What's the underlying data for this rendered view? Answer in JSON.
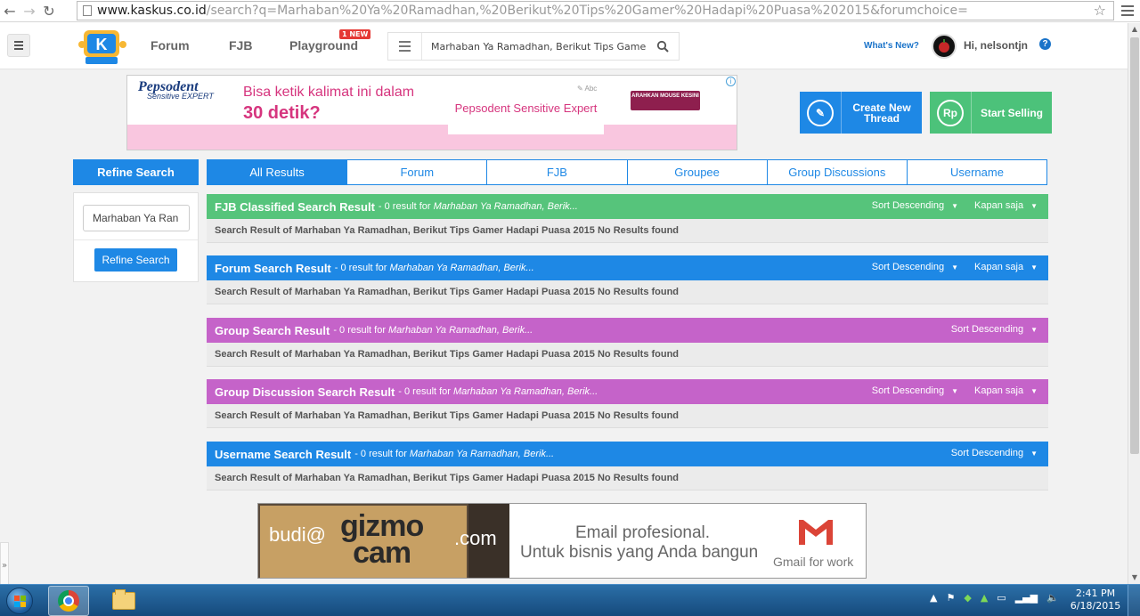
{
  "browser": {
    "url_host": "www.kaskus.co.id",
    "url_rest": "/search?q=Marhaban%20Ya%20Ramadhan,%20Berikut%20Tips%20Gamer%20Hadapi%20Puasa%202015&forumchoice="
  },
  "header": {
    "nav": [
      {
        "label": "Forum"
      },
      {
        "label": "FJB"
      },
      {
        "label": "Playground"
      }
    ],
    "new_badge": "1 NEW",
    "search_value": "Marhaban Ya Ramadhan, Berikut Tips Game",
    "whats_new": "What's New?",
    "greeting": "Hi, nelsontjn",
    "help": "?"
  },
  "ad_top": {
    "brand": "Pepsodent",
    "brand_sub": "Sensitive EXPERT",
    "line1": "Bisa ketik kalimat ini dalam",
    "line2": "30 detik?",
    "middle_text": "Pepsodent Sensitive Expert",
    "abc": "✎ Abc",
    "button": "ARAHKAN MOUSE KESINI",
    "info": "i"
  },
  "actions": {
    "create_thread": "Create New Thread",
    "start_selling": "Start Selling",
    "rp_icon": "Rp"
  },
  "refine": {
    "title": "Refine Search",
    "input_value": "Marhaban Ya Ran",
    "button": "Refine Search"
  },
  "tabs": [
    {
      "label": "All Results",
      "active": true
    },
    {
      "label": "Forum"
    },
    {
      "label": "FJB"
    },
    {
      "label": "Groupee"
    },
    {
      "label": "Group Discussions"
    },
    {
      "label": "Username"
    }
  ],
  "results": [
    {
      "title": "FJB Classified Search Result",
      "meta": "- 0 result for",
      "query": "Marhaban Ya Ramadhan, Berik...",
      "sort": "Sort Descending",
      "when": "Kapan saja",
      "body": "Search Result of Marhaban Ya Ramadhan, Berikut Tips Gamer Hadapi Puasa 2015 No Results found",
      "color": "#56c47b"
    },
    {
      "title": "Forum Search Result",
      "meta": "- 0 result for",
      "query": "Marhaban Ya Ramadhan, Berik...",
      "sort": "Sort Descending",
      "when": "Kapan saja",
      "body": "Search Result of Marhaban Ya Ramadhan, Berikut Tips Gamer Hadapi Puasa 2015 No Results found",
      "color": "#1e88e5"
    },
    {
      "title": "Group Search Result",
      "meta": "- 0 result for",
      "query": "Marhaban Ya Ramadhan, Berik...",
      "sort": "Sort Descending",
      "body": "Search Result of Marhaban Ya Ramadhan, Berikut Tips Gamer Hadapi Puasa 2015 No Results found",
      "color": "#c563c9"
    },
    {
      "title": "Group Discussion Search Result",
      "meta": "- 0 result for",
      "query": "Marhaban Ya Ramadhan, Berik...",
      "sort": "Sort Descending",
      "when": "Kapan saja",
      "body": "Search Result of Marhaban Ya Ramadhan, Berikut Tips Gamer Hadapi Puasa 2015 No Results found",
      "color": "#c563c9"
    },
    {
      "title": "Username Search Result",
      "meta": "- 0 result for",
      "query": "Marhaban Ya Ramadhan, Berik...",
      "sort": "Sort Descending",
      "body": "Search Result of Marhaban Ya Ramadhan, Berikut Tips Gamer Hadapi Puasa 2015 No Results found",
      "color": "#1e88e5"
    }
  ],
  "ad_bottom": {
    "email_left": "budi@",
    "gizmo1": "gizmo",
    "gizmo2": "cam",
    "email_right": ".com",
    "line1": "Email profesional.",
    "line2": "Untuk bisnis yang Anda bangun",
    "gmail": "Gmail for work"
  },
  "taskbar": {
    "time": "2:41 PM",
    "date": "6/18/2015"
  },
  "icons": {
    "back": "back-arrow-icon",
    "forward": "forward-arrow-icon",
    "reload": "reload-icon",
    "page": "page-icon",
    "star": "bookmark-star-icon",
    "menu": "chrome-menu-icon",
    "search": "search-icon",
    "pencil": "pencil-icon"
  }
}
